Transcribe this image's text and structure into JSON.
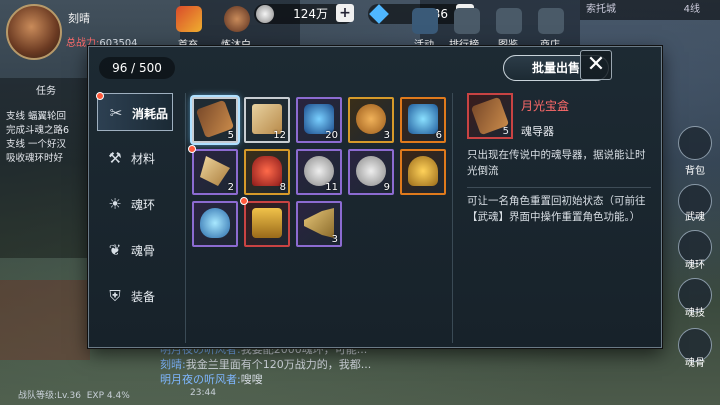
{
  "player": {
    "name": "刻晴",
    "power_label": "总战力:",
    "power_value": "603504"
  },
  "topbar": {
    "items": [
      {
        "label": "首充"
      },
      {
        "label": "炼沐白"
      },
      {
        "label": "活动"
      },
      {
        "label": "排行榜"
      },
      {
        "label": "图鉴"
      },
      {
        "label": "商店"
      }
    ],
    "currency1": "124万",
    "currency2": "8836"
  },
  "minimap": {
    "zone": "索托城",
    "line": "4线"
  },
  "tasks": {
    "header": "任务",
    "lines": [
      "支线 蝠翼轮回",
      "完成斗魂之路6",
      "支线 一个好汉",
      "吸收魂环时好"
    ]
  },
  "bag": {
    "capacity": "96 / 500",
    "bulk_sell": "批量出售",
    "close": "✕",
    "tabs": [
      {
        "label": "消耗品",
        "icon": "tools-icon"
      },
      {
        "label": "材料",
        "icon": "anvil-icon"
      },
      {
        "label": "魂环",
        "icon": "sun-ring-icon"
      },
      {
        "label": "魂骨",
        "icon": "bone-icon"
      },
      {
        "label": "装备",
        "icon": "armor-icon"
      }
    ],
    "items": [
      {
        "count": "5",
        "rarity": "red",
        "art": "chest-box"
      },
      {
        "count": "12",
        "rarity": "white",
        "art": "scroll"
      },
      {
        "count": "20",
        "rarity": "purple",
        "art": "blue-orb"
      },
      {
        "count": "3",
        "rarity": "gold",
        "art": "cookie"
      },
      {
        "count": "6",
        "rarity": "orange",
        "art": "blue-gem"
      },
      {
        "count": "2",
        "rarity": "purple",
        "art": "horn-shard"
      },
      {
        "count": "8",
        "rarity": "gold",
        "art": "fireworks"
      },
      {
        "count": "11",
        "rarity": "purple",
        "art": "coins-200"
      },
      {
        "count": "9",
        "rarity": "purple",
        "art": "coins-9"
      },
      {
        "count": "",
        "rarity": "orange",
        "art": "gold-pile"
      },
      {
        "count": "",
        "rarity": "purple",
        "art": "potion"
      },
      {
        "count": "",
        "rarity": "red",
        "art": "gold-chest"
      },
      {
        "count": "3",
        "rarity": "purple",
        "art": "trumpet"
      }
    ],
    "detail": {
      "name": "月光宝盒",
      "type": "魂导器",
      "count": "5",
      "desc": "只出现在传说中的魂导器，据说能让时光倒流",
      "use": "可让一名角色重置回初始状态（可前往【武魂】界面中操作重置角色功能。）"
    }
  },
  "right_menu": [
    "背包",
    "武魂",
    "魂环",
    "魂技",
    "魂骨"
  ],
  "chat": [
    {
      "who": "明月夜の听风者:",
      "text": "我要配2000魂环，可能..."
    },
    {
      "who": "刻晴:",
      "text": "我金兰里面有个120万战力的，我都..."
    },
    {
      "who": "明月夜の听风者:",
      "text": "嗖嗖"
    }
  ],
  "status": {
    "team_level": "战队等级:Lv.36",
    "exp": "EXP 4.4%",
    "time": "23:44"
  }
}
